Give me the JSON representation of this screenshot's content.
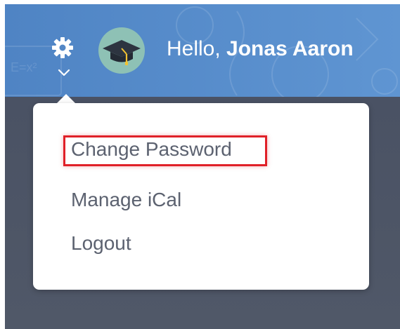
{
  "header": {
    "greeting_prefix": "Hello, ",
    "user_name": "Jonas Aaron"
  },
  "menu": {
    "items": [
      {
        "label": "Change Password",
        "highlighted": true
      },
      {
        "label": "Manage iCal"
      },
      {
        "label": "Logout"
      }
    ]
  },
  "icons": {
    "settings": "gear-icon",
    "expand": "chevron-down-icon",
    "avatar": "graduation-cap-icon"
  },
  "colors": {
    "header_blue": "#5b8fd0",
    "background_slate": "#4d5567",
    "avatar_teal": "#8ec1b5",
    "menu_text": "#5c6270",
    "highlight_red": "#e02028"
  }
}
